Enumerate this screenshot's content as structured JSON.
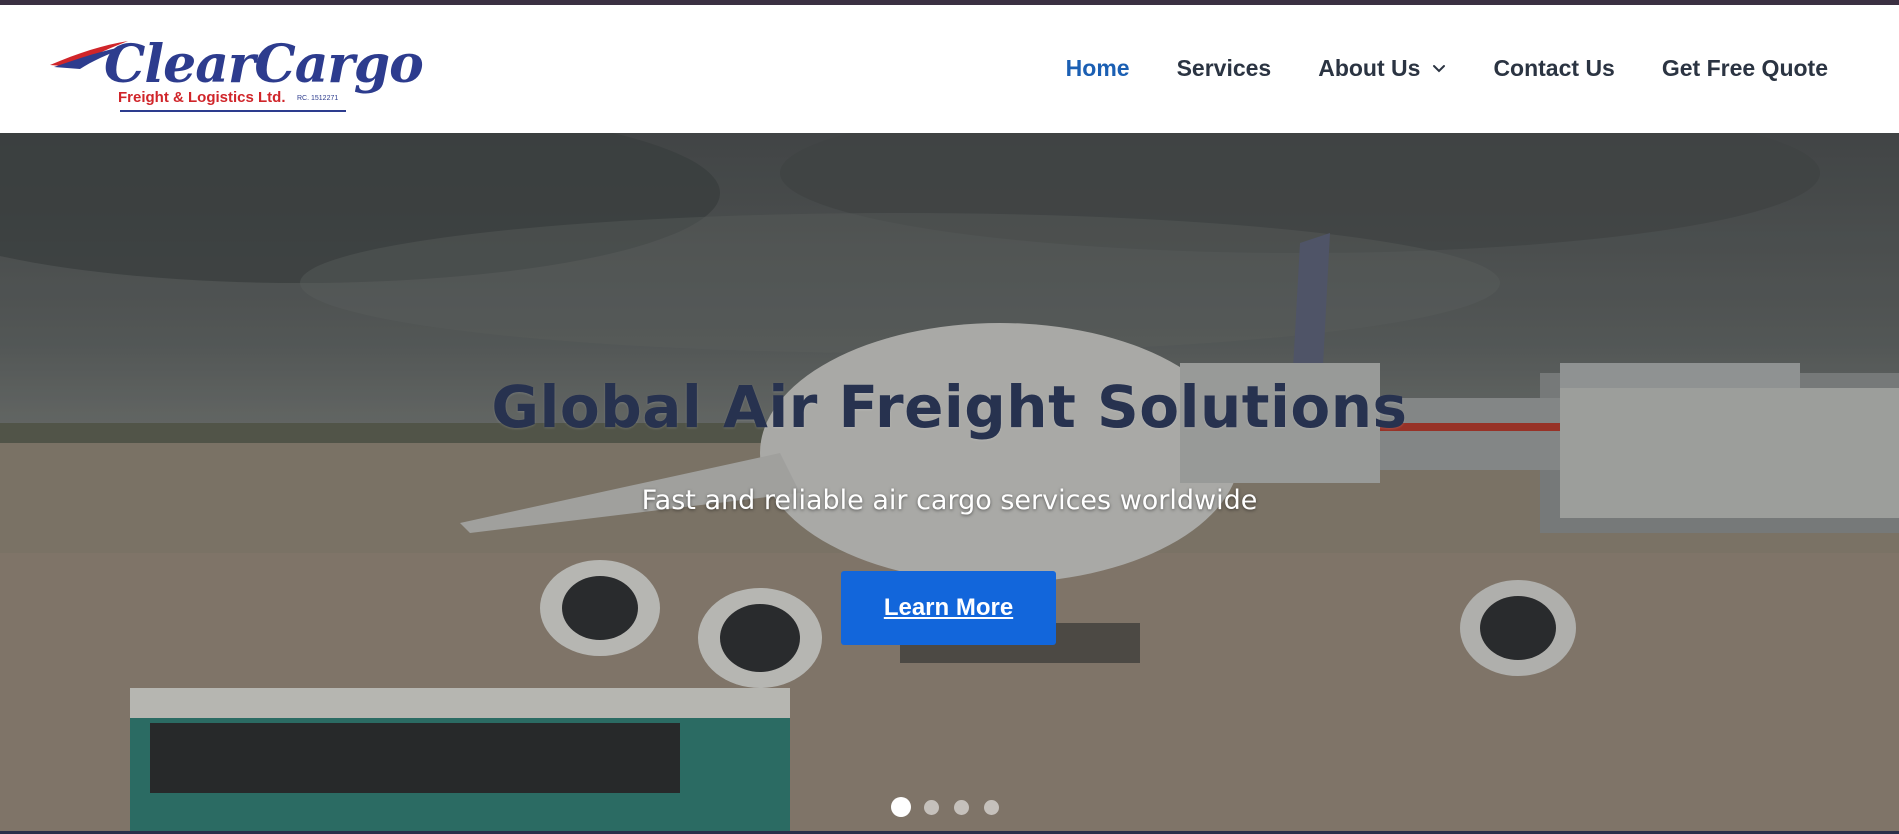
{
  "brand": {
    "name": "ClearCargo",
    "tagline": "Freight & Logistics Ltd.",
    "registration": "RC. 1512271"
  },
  "nav": {
    "items": [
      {
        "label": "Home",
        "active": true
      },
      {
        "label": "Services",
        "active": false
      },
      {
        "label": "About Us",
        "active": false,
        "has_dropdown": true
      },
      {
        "label": "Contact Us",
        "active": false
      },
      {
        "label": "Get Free Quote",
        "active": false
      }
    ]
  },
  "hero": {
    "title": "Global Air Freight Solutions",
    "subtitle": "Fast and reliable air cargo services worldwide",
    "cta_label": "Learn More",
    "slide_count": 4,
    "active_slide": 1
  },
  "colors": {
    "brand_blue": "#2d3c8e",
    "brand_red": "#d0252a",
    "nav_active": "#1b5fb3",
    "nav_text": "#2b3442",
    "cta_bg": "#1266db",
    "hero_title": "#27324f"
  }
}
